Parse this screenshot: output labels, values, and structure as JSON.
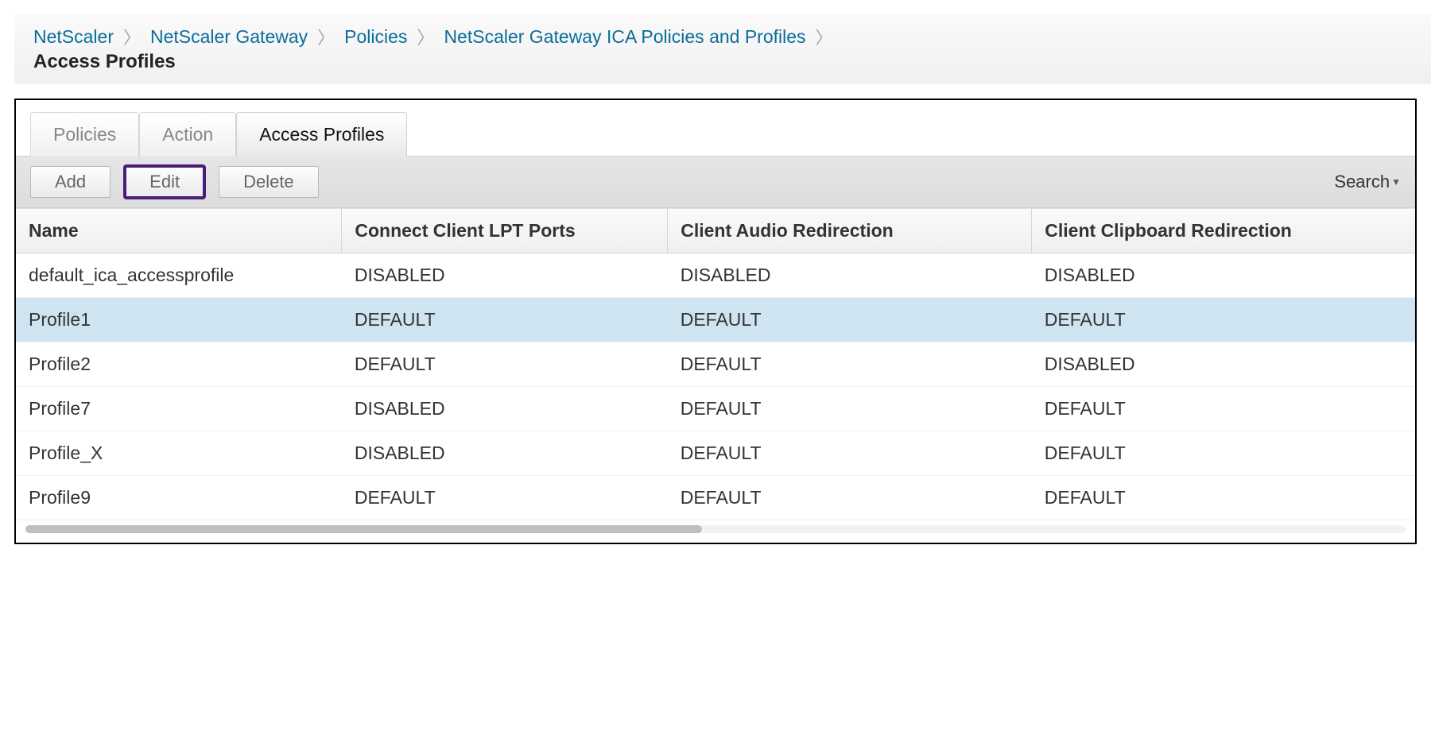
{
  "breadcrumb": {
    "items": [
      "NetScaler",
      "NetScaler Gateway",
      "Policies",
      "NetScaler Gateway ICA Policies and Profiles"
    ],
    "current": "Access Profiles"
  },
  "tabs": [
    {
      "label": "Policies",
      "active": false
    },
    {
      "label": "Action",
      "active": false
    },
    {
      "label": "Access Profiles",
      "active": true
    }
  ],
  "toolbar": {
    "add_label": "Add",
    "edit_label": "Edit",
    "delete_label": "Delete",
    "search_label": "Search"
  },
  "table": {
    "columns": [
      "Name",
      "Connect Client LPT Ports",
      "Client Audio Redirection",
      "Client Clipboard Redirection"
    ],
    "rows": [
      {
        "cells": [
          "default_ica_accessprofile",
          "DISABLED",
          "DISABLED",
          "DISABLED"
        ],
        "selected": false
      },
      {
        "cells": [
          "Profile1",
          "DEFAULT",
          "DEFAULT",
          "DEFAULT"
        ],
        "selected": true
      },
      {
        "cells": [
          "Profile2",
          "DEFAULT",
          "DEFAULT",
          "DISABLED"
        ],
        "selected": false
      },
      {
        "cells": [
          "Profile7",
          "DISABLED",
          "DEFAULT",
          "DEFAULT"
        ],
        "selected": false
      },
      {
        "cells": [
          "Profile_X",
          "DISABLED",
          "DEFAULT",
          "DEFAULT"
        ],
        "selected": false
      },
      {
        "cells": [
          "Profile9",
          "DEFAULT",
          "DEFAULT",
          "DEFAULT"
        ],
        "selected": false
      }
    ]
  }
}
